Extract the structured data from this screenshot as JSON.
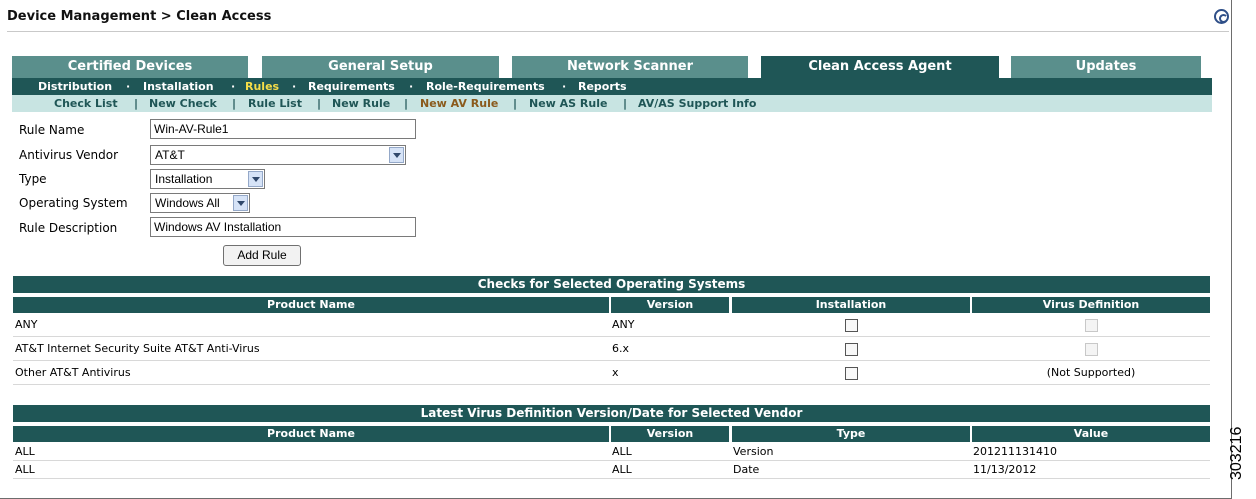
{
  "header": {
    "title": "Device Management > Clean Access",
    "figure_id": "303216"
  },
  "main_tabs": [
    {
      "label": "Certified Devices",
      "active": false
    },
    {
      "label": "General Setup",
      "active": false
    },
    {
      "label": "Network Scanner",
      "active": false
    },
    {
      "label": "Clean Access Agent",
      "active": true
    },
    {
      "label": "Updates",
      "active": false
    }
  ],
  "sub_nav": [
    {
      "label": "Distribution",
      "active": false
    },
    {
      "label": "Installation",
      "active": false
    },
    {
      "label": "Rules",
      "active": true
    },
    {
      "label": "Requirements",
      "active": false
    },
    {
      "label": "Role-Requirements",
      "active": false
    },
    {
      "label": "Reports",
      "active": false
    }
  ],
  "rule_nav": [
    {
      "label": "Check List",
      "active": false
    },
    {
      "label": "New Check",
      "active": false
    },
    {
      "label": "Rule List",
      "active": false
    },
    {
      "label": "New Rule",
      "active": false
    },
    {
      "label": "New AV Rule",
      "active": true
    },
    {
      "label": "New AS Rule",
      "active": false
    },
    {
      "label": "AV/AS Support Info",
      "active": false
    }
  ],
  "form": {
    "rule_name": {
      "label": "Rule Name",
      "value": "Win-AV-Rule1"
    },
    "antivirus_vendor": {
      "label": "Antivirus Vendor",
      "value": "AT&T"
    },
    "type": {
      "label": "Type",
      "value": "Installation"
    },
    "operating_system": {
      "label": "Operating System",
      "value": "Windows All"
    },
    "rule_description": {
      "label": "Rule Description",
      "value": "Windows AV Installation"
    },
    "submit_label": "Add Rule"
  },
  "checks_table": {
    "title": "Checks for Selected Operating Systems",
    "headers": [
      "Product Name",
      "Version",
      "Installation",
      "Virus Definition"
    ],
    "rows": [
      {
        "product": "ANY",
        "version": "ANY",
        "installation": false,
        "virus_definition": "checkbox-disabled"
      },
      {
        "product": "AT&T Internet Security Suite AT&T Anti-Virus",
        "version": "6.x",
        "installation": false,
        "virus_definition": "checkbox-disabled"
      },
      {
        "product": "Other AT&T Antivirus",
        "version": "x",
        "installation": false,
        "virus_definition_text": "(Not Supported)"
      }
    ]
  },
  "latest_table": {
    "title": "Latest Virus Definition Version/Date for Selected Vendor",
    "headers": [
      "Product Name",
      "Version",
      "Type",
      "Value"
    ],
    "rows": [
      {
        "product": "ALL",
        "version": "ALL",
        "type": "Version",
        "value": "201211131410"
      },
      {
        "product": "ALL",
        "version": "ALL",
        "type": "Date",
        "value": "11/13/2012"
      }
    ]
  },
  "colors": {
    "dark_teal": "#1f5656",
    "tab_teal": "#5a8f8c",
    "light_band": "#c8e4e2",
    "active_yellow": "#f6dd48",
    "active_rule_link": "#8a5a1c"
  }
}
